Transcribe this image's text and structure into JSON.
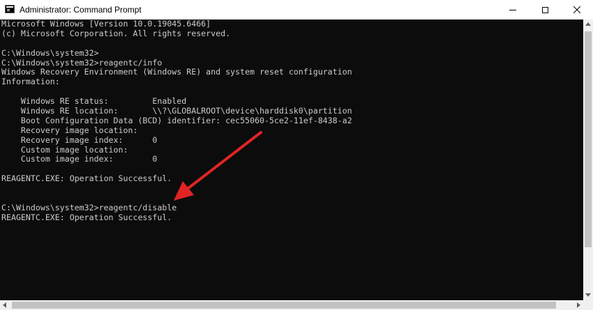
{
  "window": {
    "title": "Administrator: Command Prompt",
    "icon": "cmd-icon",
    "controls": {
      "minimize": "minimize-icon",
      "maximize": "maximize-icon",
      "close": "close-icon"
    }
  },
  "console": {
    "lines": [
      "Microsoft Windows [Version 10.0.19045.6466]",
      "(c) Microsoft Corporation. All rights reserved.",
      "",
      "C:\\Windows\\system32>",
      "C:\\Windows\\system32>reagentc/info",
      "Windows Recovery Environment (Windows RE) and system reset configuration",
      "Information:",
      "",
      "    Windows RE status:         Enabled",
      "    Windows RE location:       \\\\?\\GLOBALROOT\\device\\harddisk0\\partition",
      "    Boot Configuration Data (BCD) identifier: cec55060-5ce2-11ef-8438-a2",
      "    Recovery image location:",
      "    Recovery image index:      0",
      "    Custom image location:",
      "    Custom image index:        0",
      "",
      "REAGENTC.EXE: Operation Successful.",
      "",
      "",
      "C:\\Windows\\system32>reagentc/disable",
      "REAGENTC.EXE: Operation Successful."
    ]
  },
  "colors": {
    "console_background": "#0c0c0c",
    "console_text": "#cccccc",
    "titlebar_background": "#ffffff",
    "annotation_arrow": "#e02424"
  },
  "annotation": {
    "icon": "red-arrow-icon"
  }
}
